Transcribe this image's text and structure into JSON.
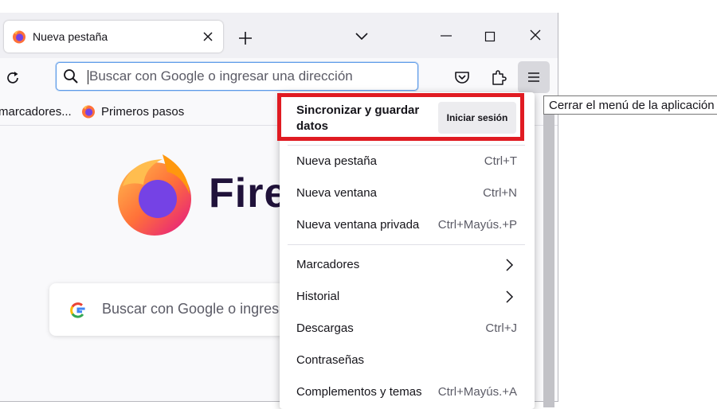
{
  "tab": {
    "title": "Nueva pestaña"
  },
  "urlbar": {
    "placeholder": "Buscar con Google o ingresar una dirección",
    "value": ""
  },
  "bookmarks": {
    "items": [
      {
        "label": "marcadores..."
      },
      {
        "label": "Primeros pasos"
      }
    ]
  },
  "newtab": {
    "wordmark": "Fire",
    "search_placeholder": "Buscar con Google o ingres"
  },
  "app_menu": {
    "sync_title": "Sincronizar y guardar datos",
    "signin_label": "Iniciar sesión",
    "items": [
      {
        "label": "Nueva pestaña",
        "shortcut": "Ctrl+T"
      },
      {
        "label": "Nueva ventana",
        "shortcut": "Ctrl+N"
      },
      {
        "label": "Nueva ventana privada",
        "shortcut": "Ctrl+Mayús.+P"
      },
      {
        "label": "Marcadores",
        "shortcut": ""
      },
      {
        "label": "Historial",
        "shortcut": ""
      },
      {
        "label": "Descargas",
        "shortcut": "Ctrl+J"
      },
      {
        "label": "Contraseñas",
        "shortcut": ""
      },
      {
        "label": "Complementos y temas",
        "shortcut": "Ctrl+Mayús.+A"
      }
    ]
  },
  "tooltip": {
    "text": "Cerrar el menú de la aplicación"
  },
  "colors": {
    "highlight": "#e01b22",
    "accent": "#5c9ae8",
    "menu_button_bg": "#d8d8dd"
  }
}
